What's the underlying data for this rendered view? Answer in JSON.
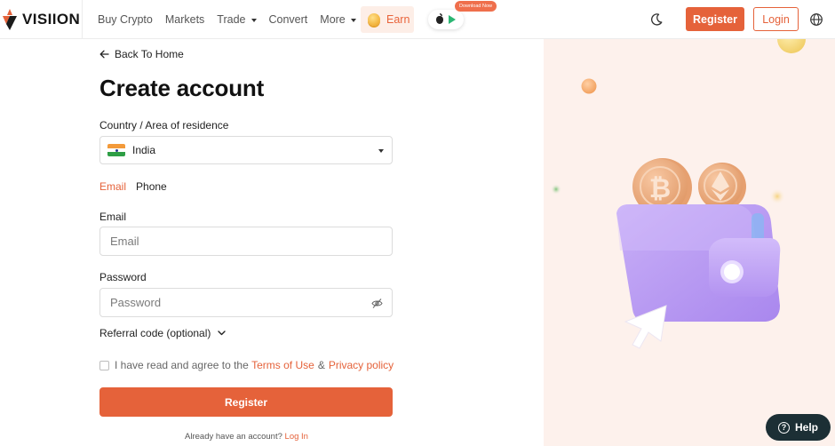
{
  "brand": {
    "name": "VISIION",
    "accent": "#e5623a"
  },
  "nav": {
    "items": [
      {
        "label": "Buy Crypto",
        "dropdown": false
      },
      {
        "label": "Markets",
        "dropdown": false
      },
      {
        "label": "Trade",
        "dropdown": true
      },
      {
        "label": "Convert",
        "dropdown": false
      },
      {
        "label": "More",
        "dropdown": true
      }
    ],
    "earn_label": "Earn",
    "download_badge": "Download Now"
  },
  "header": {
    "register_label": "Register",
    "login_label": "Login",
    "icons": [
      "moon-icon",
      "globe-icon",
      "apple-icon",
      "google-play-icon"
    ]
  },
  "form": {
    "back_label": "Back To Home",
    "title": "Create account",
    "country_label": "Country / Area of residence",
    "country_value": "India",
    "tabs": [
      {
        "label": "Email",
        "active": true
      },
      {
        "label": "Phone",
        "active": false
      }
    ],
    "email_label": "Email",
    "email_placeholder": "Email",
    "password_label": "Password",
    "password_placeholder": "Password",
    "referral_label": "Referral code (optional)",
    "agree_text": "I have read and agree to the",
    "terms_label": "Terms of Use",
    "and_sign": "&",
    "privacy_label": "Privacy policy",
    "submit_label": "Register",
    "already_text": "Already have an account?",
    "login_link": "Log In"
  },
  "help": {
    "label": "Help",
    "icon": "question-icon"
  }
}
